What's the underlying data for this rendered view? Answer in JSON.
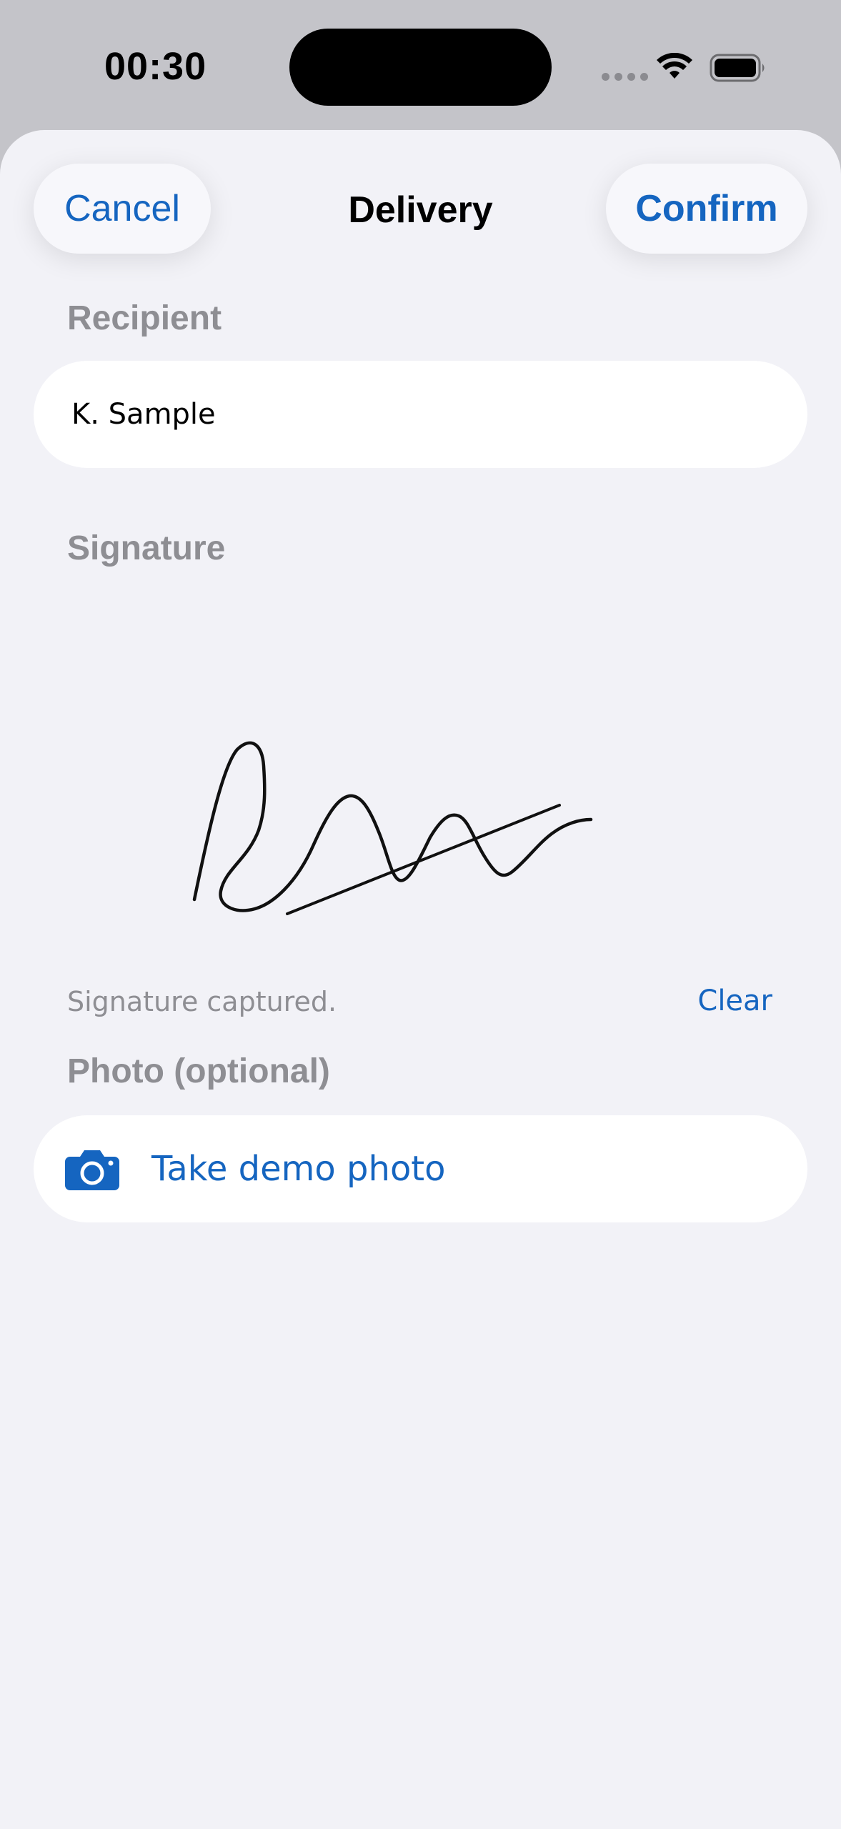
{
  "status_bar": {
    "time": "00:30"
  },
  "nav": {
    "cancel_label": "Cancel",
    "title": "Delivery",
    "confirm_label": "Confirm"
  },
  "recipient": {
    "label": "Recipient",
    "value": "K. Sample"
  },
  "signature": {
    "label": "Signature",
    "status": "Signature captured.",
    "clear_label": "Clear"
  },
  "photo": {
    "label": "Photo (optional)",
    "button_label": "Take demo photo",
    "icon": "camera-icon"
  },
  "colors": {
    "accent": "#1565c0",
    "secondary_text": "#8e8e93",
    "background": "#f2f2f7"
  }
}
